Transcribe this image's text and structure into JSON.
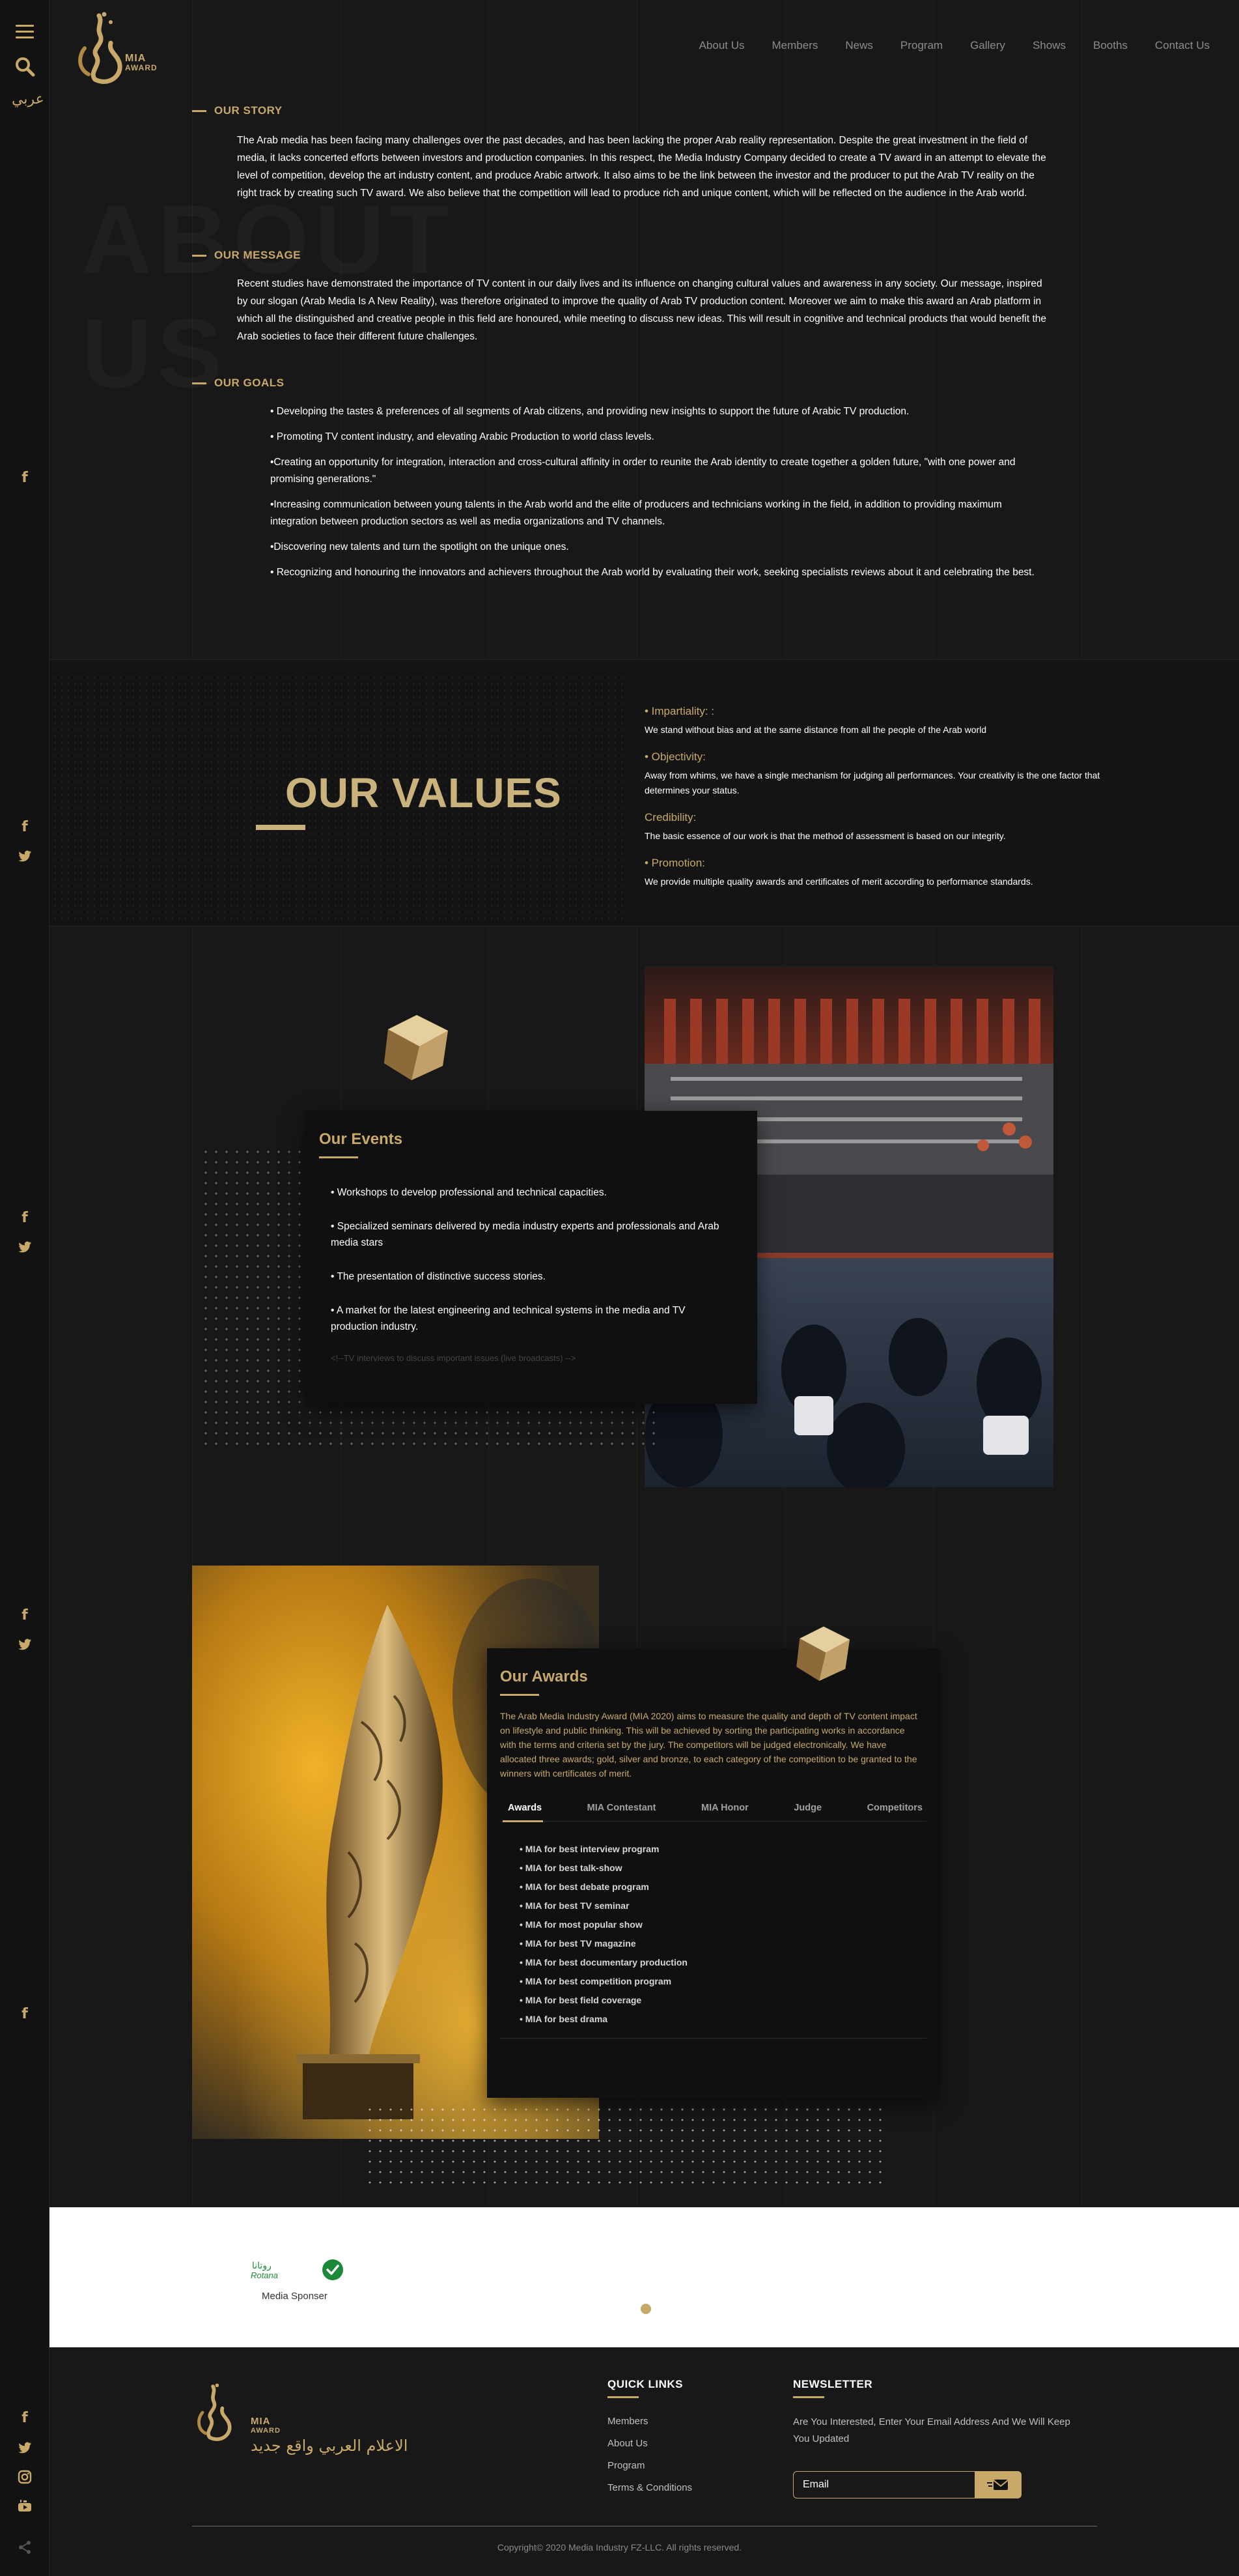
{
  "colors": {
    "accent": "#c9a96a",
    "background": "#181818",
    "card": "#101010"
  },
  "rail": {
    "arabic_link": "عربي",
    "icons": [
      "menu-icon",
      "search-icon",
      "facebook-icon",
      "twitter-icon",
      "instagram-icon",
      "youtube-icon",
      "share-icon"
    ]
  },
  "logo": {
    "line1": "MIA",
    "line2": "AWARD"
  },
  "nav": [
    "About Us",
    "Members",
    "News",
    "Program",
    "Gallery",
    "Shows",
    "Booths",
    "Contact Us"
  ],
  "about": {
    "watermark_line1": "ABOUT",
    "watermark_line2": "US",
    "story_title": "OUR STORY",
    "story_text": "The Arab media has been facing many challenges over the past decades, and has been lacking the proper Arab reality representation. Despite the great investment in the field of media, it lacks concerted efforts between investors and production companies. In this respect, the Media Industry Company decided to create a TV award in an attempt to elevate the level of competition, develop the art industry content, and produce Arabic artwork. It also aims to be the link between the investor and the producer to put the Arab TV reality on the right track by creating such TV award. We also believe that the competition will lead to produce rich and unique content, which will be reflected on the audience in the Arab world.",
    "message_title": "OUR MESSAGE",
    "message_text": "Recent studies have demonstrated the importance of TV content in our daily lives and its influence on changing cultural values and awareness in any society. Our message, inspired by our slogan (Arab Media Is A New Reality), was therefore originated to improve the quality of Arab TV production content. Moreover we aim to make this award an Arab platform in which all the distinguished and creative people in this field are honoured, while meeting to discuss new ideas. This will result in cognitive and technical products that would benefit the Arab societies to face their different future challenges.",
    "goals_title": "OUR GOALS",
    "goals": [
      "• Developing the tastes & preferences of all segments of Arab citizens, and providing new insights to support the future of Arabic TV production.",
      "• Promoting TV content industry, and elevating Arabic Production to world class levels.",
      "•Creating an opportunity for integration, interaction and cross-cultural affinity in order to reunite the Arab identity to create together a golden future, \"with one power and promising generations.\"",
      "•Increasing communication between young talents in the Arab world and the elite of producers and technicians working in the field, in addition to providing maximum integration between production sectors as well as media organizations and TV channels.",
      "•Discovering new talents and turn the spotlight on the unique ones.",
      "• Recognizing and honouring the innovators and achievers throughout the Arab world by evaluating their work, seeking specialists reviews about it and celebrating the best."
    ]
  },
  "values": {
    "title": "OUR VALUES",
    "items": [
      {
        "title": "• Impartiality: :",
        "desc": "We stand without bias and at the same distance from all the people of the Arab world"
      },
      {
        "title": "• Objectivity:",
        "desc": "Away from whims, we have a single mechanism for judging all performances. Your creativity is the one factor that determines your status."
      },
      {
        "title": "Credibility:",
        "desc": "The basic essence of our work is that the method of assessment is based on our integrity."
      },
      {
        "title": "• Promotion:",
        "desc": "We provide multiple quality awards and certificates of merit according to performance standards."
      }
    ]
  },
  "events": {
    "title": "Our Events",
    "items": [
      "• Workshops to develop professional and technical capacities.",
      "• Specialized seminars delivered by media industry experts and professionals and Arab media stars",
      "• The presentation of distinctive success stories.",
      "• A market for the latest engineering and technical systems in the media and TV production industry."
    ],
    "faded_item": "<!--TV interviews to discuss important issues (live broadcasts) -->"
  },
  "awards": {
    "title": "Our Awards",
    "description": "The Arab Media Industry Award (MIA 2020) aims to measure the quality and depth of TV content impact on lifestyle and public thinking. This will be achieved by sorting the participating works in accordance with the terms and criteria set by the jury. The competitors will be judged electronically. We have allocated three awards; gold, silver and bronze, to each category of the competition to be granted to the winners with certificates of merit.",
    "tabs": [
      "Awards",
      "MIA Contestant",
      "MIA Honor",
      "Judge",
      "Competitors"
    ],
    "active_tab": "Awards",
    "list": [
      "• MIA for best interview program",
      "• MIA for best talk-show",
      "• MIA for best debate program",
      "• MIA for best TV seminar",
      "• MIA for most popular show",
      "• MIA for best TV magazine",
      "• MIA for best documentary production",
      "• MIA for best competition program",
      "• MIA for best field coverage",
      "• MIA for best drama"
    ]
  },
  "sponsor": {
    "logo_text": "Rotana",
    "caption": "Media Sponser"
  },
  "footer": {
    "slogan": "الاعلام العربي واقع جديد",
    "logo_line1": "MIA",
    "logo_line2": "AWARD",
    "quick_links_title": "QUICK LINKS",
    "quick_links": [
      "Members",
      "About Us",
      "Program",
      "Terms & Conditions"
    ],
    "newsletter_title": "NEWSLETTER",
    "newsletter_text": "Are You Interested, Enter Your Email Address And We Will Keep You Updated",
    "email_placeholder": "Email",
    "copyright": "Copyright© 2020 Media Industry FZ-LLC. All rights reserved."
  }
}
